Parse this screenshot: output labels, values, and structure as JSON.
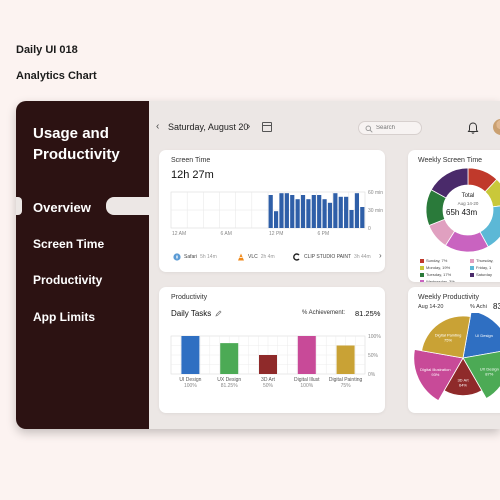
{
  "header": {
    "line1": "Daily UI 018",
    "line2": "Analytics Chart"
  },
  "sidebar": {
    "title": "Usage and\nProductivity",
    "items": [
      {
        "label": "Overview",
        "active": true
      },
      {
        "label": "Screen Time"
      },
      {
        "label": "Productivity"
      },
      {
        "label": "App Limits"
      }
    ]
  },
  "topbar": {
    "date": "Saturday, August 20",
    "prev_icon": "chevron-left-icon",
    "next_icon": "chevron-right-icon",
    "search_placeholder": "Search"
  },
  "screen_time": {
    "label": "Screen Time",
    "value": "12h 27m",
    "chart_data": {
      "type": "bar",
      "x_ticks": [
        "12 AM",
        "6 AM",
        "12 PM",
        "6 PM"
      ],
      "y_ticks": [
        "60 min",
        "30 min",
        "0"
      ],
      "ylim": [
        0,
        60
      ],
      "values": [
        0,
        0,
        0,
        0,
        0,
        0,
        0,
        0,
        0,
        0,
        0,
        0,
        0,
        0,
        0,
        0,
        0,
        0,
        55,
        28,
        58,
        58,
        55,
        48,
        55,
        48,
        55,
        55,
        48,
        42,
        58,
        52,
        52,
        30,
        58,
        35
      ],
      "color": "#2f5fa8"
    },
    "apps": [
      {
        "name": "Safari",
        "time": "5h 14m",
        "icon": "safari-icon"
      },
      {
        "name": "VLC",
        "time": "2h 4m",
        "icon": "vlc-icon"
      },
      {
        "name": "CLIP STUDIO PAINT",
        "time": "3h 44m",
        "icon": "clip-studio-icon"
      }
    ]
  },
  "productivity": {
    "label": "Productivity",
    "tasks_title": "Daily Tasks",
    "achievement_label": "% Achievement:",
    "achievement_value": "81.25%",
    "chart_data": {
      "type": "bar",
      "y_ticks": [
        "100%",
        "50%",
        "0%"
      ],
      "ylim": [
        0,
        100
      ],
      "categories": [
        "UI Design",
        "UX Design",
        "3D Art",
        "Digital Illust",
        "Digital Painting"
      ],
      "values": [
        100,
        81.25,
        50,
        100,
        75
      ],
      "value_labels": [
        "100%",
        "81.25%",
        "50%",
        "100%",
        "75%"
      ],
      "colors": [
        "#2f6fc2",
        "#4caa55",
        "#8f2a2a",
        "#c84a98",
        "#c9a235"
      ]
    }
  },
  "weekly_screen": {
    "label": "Weekly Screen Time",
    "range": "Aug 14-20",
    "total_label": "Total",
    "total_value": "65h 43m",
    "chart_data": {
      "type": "pie",
      "slices": [
        {
          "label": "Sunday",
          "color": "#c0392b"
        },
        {
          "label": "Monday",
          "color": "#c9c83a"
        },
        {
          "label": "Tuesday",
          "color": "#5cb8d6"
        },
        {
          "label": "Wednesday",
          "color": "#c963c0"
        },
        {
          "label": "Thursday",
          "color": "#e0a0c0"
        },
        {
          "label": "Friday",
          "color": "#2a7a3a"
        },
        {
          "label": "Saturday",
          "color": "#4a2a6a"
        }
      ],
      "values": [
        12,
        11,
        19,
        17,
        10,
        14,
        17
      ]
    },
    "legend": [
      {
        "label": "Sunday, 7%",
        "color": "#c0392b"
      },
      {
        "label": "Thursday,",
        "color": "#e0a0c0"
      },
      {
        "label": "Monday, 19%",
        "color": "#c9c83a"
      },
      {
        "label": "Friday, 1",
        "color": "#5cb8d6"
      },
      {
        "label": "Tuesday, 17%",
        "color": "#2a7a3a"
      },
      {
        "label": "Saturday",
        "color": "#4a2a6a"
      },
      {
        "label": "Wednesday, 3%",
        "color": "#c963c0"
      }
    ]
  },
  "weekly_prod": {
    "label": "Weekly Productivity",
    "range": "Aug 14-20",
    "achievement_label": "% Achi",
    "achievement_value": "83",
    "chart_data": {
      "type": "pie",
      "slices": [
        {
          "label": "UI Design",
          "pct": "",
          "color": "#2f6fc2"
        },
        {
          "label": "UX Design",
          "pct": "87%",
          "color": "#4caa55"
        },
        {
          "label": "3D Art",
          "pct": "64%",
          "color": "#8f2a2a"
        },
        {
          "label": "Digital Illustration",
          "pct": "93%",
          "color": "#c84a98"
        },
        {
          "label": "Digital Painting",
          "pct": "75%",
          "color": "#c9a235"
        }
      ],
      "values": [
        90,
        87,
        64,
        93,
        75
      ]
    }
  }
}
